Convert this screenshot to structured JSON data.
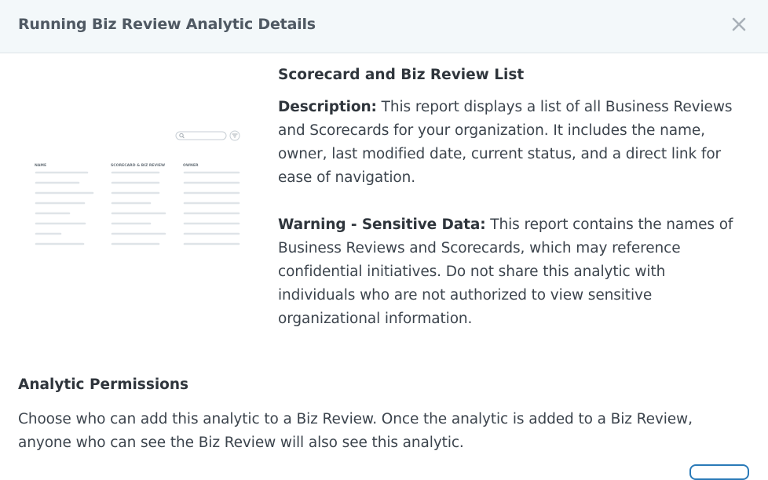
{
  "dialog": {
    "title": "Running Biz Review Analytic Details",
    "close_icon": "close-icon"
  },
  "thumbnail": {
    "columns": [
      "NAME",
      "SCORECARD & BIZ REVIEW",
      "OWNER"
    ],
    "icons": [
      "search-icon",
      "filter-icon"
    ]
  },
  "report": {
    "name": "Scorecard and Biz Review List",
    "description_label": "Description:",
    "description_text": " This report displays a list of all Business Reviews and Scorecards for your organization. It includes the name, owner, last modified date, current status, and a direct link for ease of navigation.",
    "warning_label": "Warning - Sensitive Data:",
    "warning_text": " This report contains the names of Business Reviews and Scorecards, which may reference confidential initiatives. Do not share this analytic with individuals who are not authorized to view sensitive organizational information."
  },
  "permissions": {
    "title": "Analytic Permissions",
    "text": "Choose who can add this analytic to a Biz Review. Once the analytic is added to a Biz Review, anyone who can see the Biz Review will also see this analytic."
  },
  "colors": {
    "header_bg": "#f3f8fa",
    "accent": "#2a7ab8",
    "placeholder_line": "#dde3e8"
  }
}
